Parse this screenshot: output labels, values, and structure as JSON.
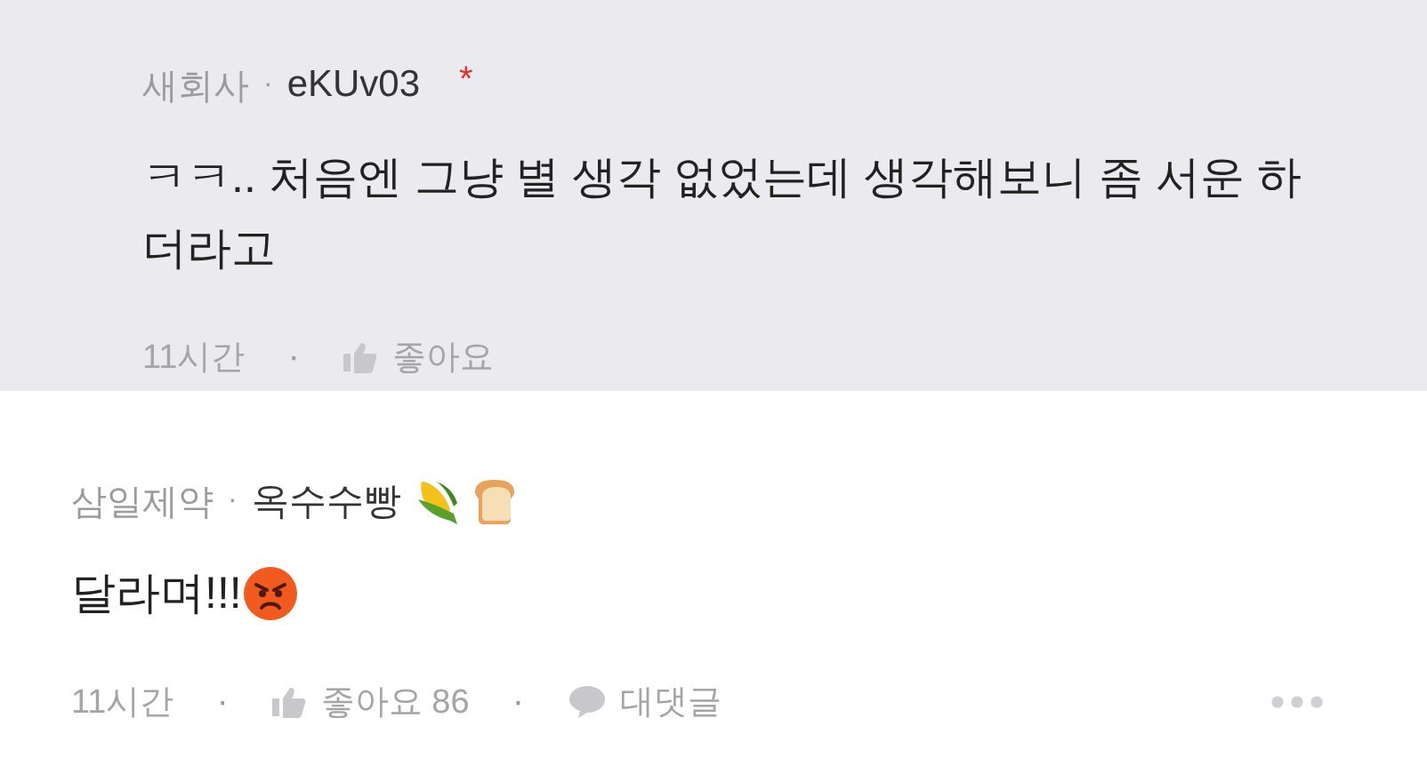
{
  "comments": [
    {
      "kind": "reply",
      "company": "새회사",
      "separator": "·",
      "nickname": "eKUv03",
      "author_mark": "*",
      "text": "ㅋㅋ.. 처음엔 그냥 별 생각 없었는데 생각해보니 좀 서운 하더라고",
      "time": "11시간",
      "footer_separator": "·",
      "like_label": "좋아요"
    },
    {
      "kind": "comment",
      "company": "삼일제약",
      "separator": "·",
      "nickname": "옥수수빵",
      "text": "달라며!!!",
      "time": "11시간",
      "footer_separator": "·",
      "like_label": "좋아요",
      "like_count": "86",
      "reply_separator": "·",
      "reply_label": "대댓글"
    }
  ]
}
